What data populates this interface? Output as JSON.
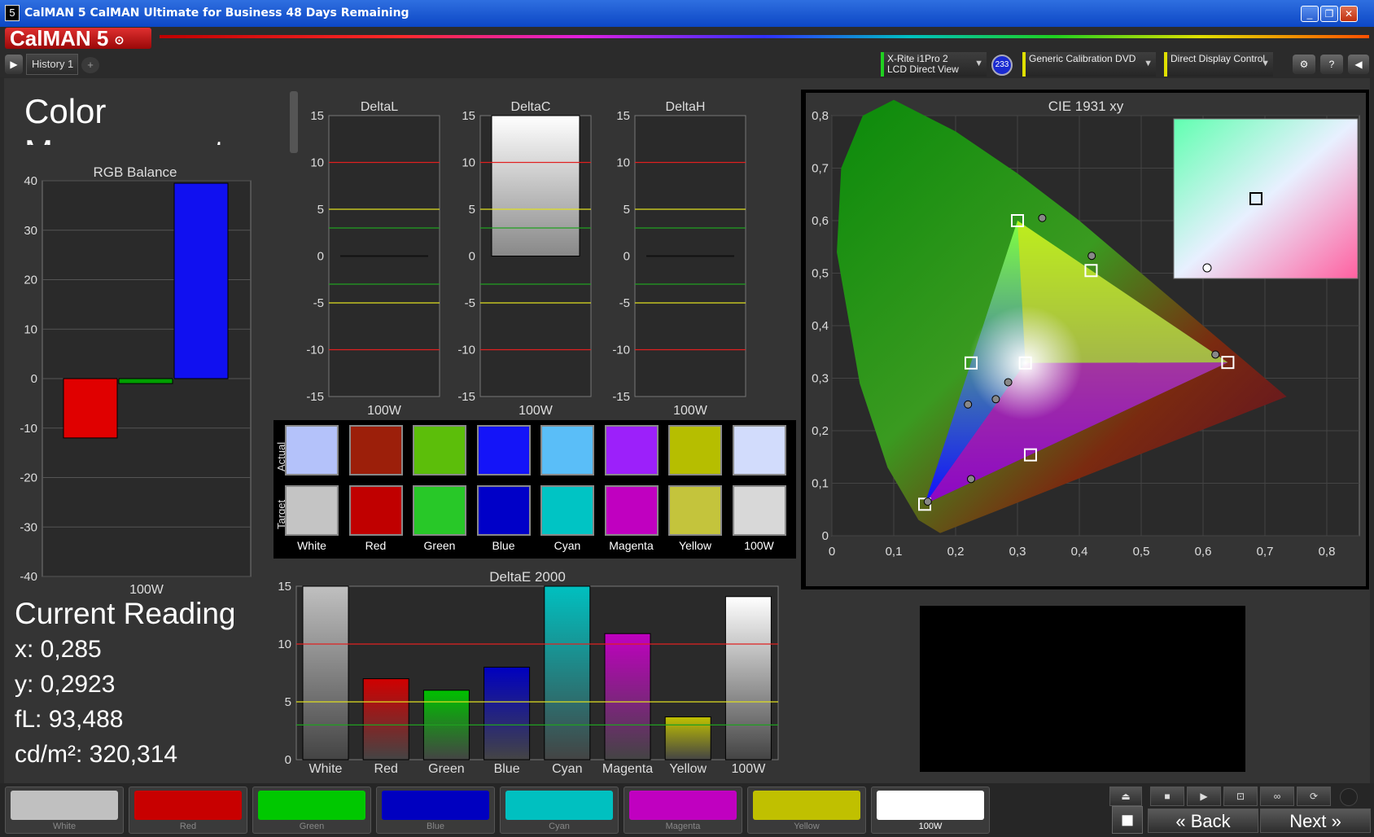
{
  "window": {
    "title": "CalMAN 5 CalMAN Ultimate for Business 48 Days Remaining",
    "app_icon": "5",
    "minimize": "_",
    "restore": "❐",
    "close": "✕"
  },
  "brand": {
    "logo": "CalMAN 5"
  },
  "toolbar": {
    "history_tab": "History 1",
    "add_tab": "+",
    "meter": {
      "line1": "X-Rite i1Pro 2",
      "line2": "LCD Direct View",
      "badge": "233"
    },
    "source": {
      "label": "Generic Calibration DVD"
    },
    "display": {
      "label": "Direct Display Control"
    },
    "icons": [
      "gear-icon",
      "help-icon",
      "collapse-icon"
    ]
  },
  "page": {
    "title_line1": "Color",
    "title_line2": "Management"
  },
  "rgb_balance": {
    "title": "RGB Balance",
    "x_label": "100W",
    "ylim": [
      -40,
      40
    ],
    "ticks": [
      "40",
      "30",
      "20",
      "10",
      "0",
      "-10",
      "-20",
      "-30",
      "-40"
    ]
  },
  "delta_charts": [
    {
      "title": "DeltaL",
      "x_label": "100W"
    },
    {
      "title": "DeltaC",
      "x_label": "100W"
    },
    {
      "title": "DeltaH",
      "x_label": "100W"
    }
  ],
  "delta_ticks": [
    "15",
    "10",
    "5",
    "0",
    "-5",
    "-10",
    "-15"
  ],
  "swatches": {
    "actual_label": "Actual",
    "target_label": "Target",
    "names": [
      "White",
      "Red",
      "Green",
      "Blue",
      "Cyan",
      "Magenta",
      "Yellow",
      "100W"
    ],
    "actual": [
      "#b4c2fa",
      "#9c1f0a",
      "#5cbe0a",
      "#1414f8",
      "#5abef8",
      "#9c20fa",
      "#b6be00",
      "#d2dcfc"
    ],
    "target": [
      "#c4c4c4",
      "#c00000",
      "#28c828",
      "#0000c8",
      "#00c4c4",
      "#c000c0",
      "#c4c43c",
      "#d8d8d8"
    ]
  },
  "deltae": {
    "title": "DeltaE 2000",
    "ticks": [
      "15",
      "10",
      "5",
      "0"
    ],
    "categories": [
      "White",
      "Red",
      "Green",
      "Blue",
      "Cyan",
      "Magenta",
      "Yellow",
      "100W"
    ]
  },
  "cie": {
    "title": "CIE 1931 xy",
    "xticks": [
      "0",
      "0,1",
      "0,2",
      "0,3",
      "0,4",
      "0,5",
      "0,6",
      "0,7",
      "0,8"
    ],
    "yticks": [
      "0",
      "0,1",
      "0,2",
      "0,3",
      "0,4",
      "0,5",
      "0,6",
      "0,7",
      "0,8"
    ]
  },
  "reading": {
    "title": "Current Reading",
    "x": "x: 0,285",
    "y": "y: 0,2923",
    "fl": "fL: 93,488",
    "cdm2": "cd/m²: 320,314"
  },
  "bottom": {
    "tiles": [
      {
        "name": "White",
        "color": "#c0c0c0"
      },
      {
        "name": "Red",
        "color": "#c80000"
      },
      {
        "name": "Green",
        "color": "#00c800"
      },
      {
        "name": "Blue",
        "color": "#0000c0"
      },
      {
        "name": "Cyan",
        "color": "#00c0c0"
      },
      {
        "name": "Magenta",
        "color": "#c000c0"
      },
      {
        "name": "Yellow",
        "color": "#c0c000"
      },
      {
        "name": "100W",
        "color": "#ffffff"
      }
    ],
    "back": "Back",
    "next": "Next",
    "back_arrow": "«",
    "next_arrow": "»"
  },
  "chart_data": [
    {
      "type": "bar",
      "title": "RGB Balance",
      "categories": [
        "100W"
      ],
      "series": [
        {
          "color": "#e00000",
          "values": [
            -12
          ]
        },
        {
          "color": "#00a000",
          "values": [
            -1
          ]
        },
        {
          "color": "#1010f0",
          "values": [
            39.5
          ]
        }
      ],
      "ylim": [
        -40,
        40
      ],
      "xlabel": "100W"
    },
    {
      "type": "bar",
      "title": "DeltaL",
      "categories": [
        "100W"
      ],
      "values": [
        0
      ],
      "ylim": [
        -15,
        15
      ]
    },
    {
      "type": "bar",
      "title": "DeltaC",
      "categories": [
        "100W"
      ],
      "values": [
        15
      ],
      "ylim": [
        -15,
        15
      ]
    },
    {
      "type": "bar",
      "title": "DeltaH",
      "categories": [
        "100W"
      ],
      "values": [
        0
      ],
      "ylim": [
        -15,
        15
      ]
    },
    {
      "type": "bar",
      "title": "DeltaE 2000",
      "categories": [
        "White",
        "Red",
        "Green",
        "Blue",
        "Cyan",
        "Magenta",
        "Yellow",
        "100W"
      ],
      "values": [
        15,
        7,
        6,
        8,
        15,
        10.9,
        3.7,
        14.1
      ],
      "colors": [
        "#c0c0c0",
        "#d00000",
        "#00c000",
        "#0000c0",
        "#00c0c0",
        "#c000c0",
        "#c0c000",
        "#ffffff"
      ],
      "ylim": [
        0,
        15
      ]
    },
    {
      "type": "scatter",
      "title": "CIE 1931 xy",
      "xlim": [
        0,
        0.8
      ],
      "ylim": [
        0,
        0.8
      ],
      "targets": [
        [
          0.64,
          0.33
        ],
        [
          0.3,
          0.6
        ],
        [
          0.15,
          0.06
        ],
        [
          0.225,
          0.329
        ],
        [
          0.321,
          0.154
        ],
        [
          0.419,
          0.505
        ],
        [
          0.3127,
          0.329
        ]
      ],
      "actuals": [
        [
          0.62,
          0.345
        ],
        [
          0.34,
          0.605
        ],
        [
          0.155,
          0.065
        ],
        [
          0.22,
          0.25
        ],
        [
          0.225,
          0.108
        ],
        [
          0.42,
          0.533
        ],
        [
          0.265,
          0.26
        ],
        [
          0.285,
          0.2923
        ]
      ]
    }
  ]
}
